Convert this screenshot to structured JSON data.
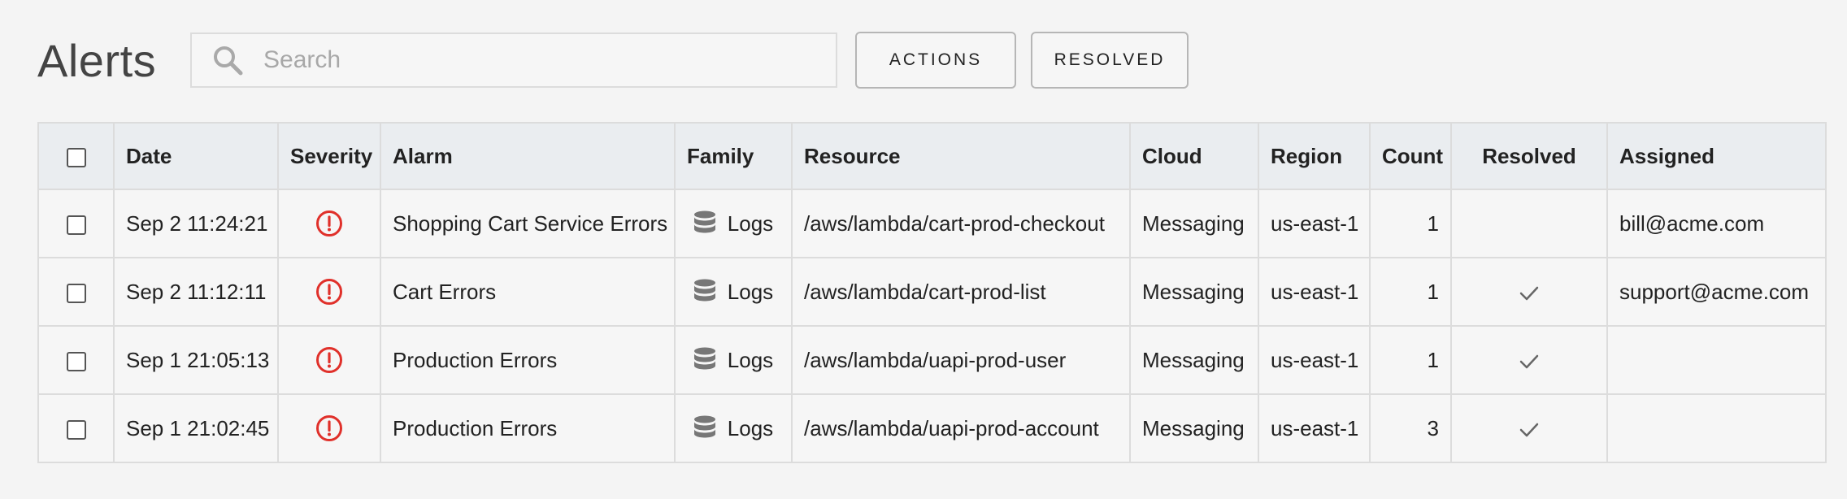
{
  "header": {
    "title": "Alerts",
    "search_placeholder": "Search",
    "search_value": "",
    "actions_label": "ACTIONS",
    "resolved_label": "RESOLVED"
  },
  "table": {
    "columns": [
      "Date",
      "Severity",
      "Alarm",
      "Family",
      "Resource",
      "Cloud",
      "Region",
      "Count",
      "Resolved",
      "Assigned"
    ],
    "rows": [
      {
        "date": "Sep 2 11:24:21",
        "severity": "error",
        "alarm": "Shopping Cart Service Errors",
        "family": "Logs",
        "resource": "/aws/lambda/cart-prod-checkout",
        "cloud": "Messaging",
        "region": "us-east-1",
        "count": "1",
        "resolved": false,
        "assigned": "bill@acme.com"
      },
      {
        "date": "Sep 2 11:12:11",
        "severity": "error",
        "alarm": "Cart Errors",
        "family": "Logs",
        "resource": "/aws/lambda/cart-prod-list",
        "cloud": "Messaging",
        "region": "us-east-1",
        "count": "1",
        "resolved": true,
        "assigned": "support@acme.com"
      },
      {
        "date": "Sep 1 21:05:13",
        "severity": "error",
        "alarm": "Production Errors",
        "family": "Logs",
        "resource": "/aws/lambda/uapi-prod-user",
        "cloud": "Messaging",
        "region": "us-east-1",
        "count": "1",
        "resolved": true,
        "assigned": ""
      },
      {
        "date": "Sep 1 21:02:45",
        "severity": "error",
        "alarm": "Production Errors",
        "family": "Logs",
        "resource": "/aws/lambda/uapi-prod-account",
        "cloud": "Messaging",
        "region": "us-east-1",
        "count": "3",
        "resolved": true,
        "assigned": ""
      }
    ]
  },
  "icons": {
    "search": "search-icon",
    "severity": "alert-circle-icon",
    "family": "database-icon",
    "resolved": "check-icon"
  },
  "colors": {
    "severity_error": "#e0302a",
    "header_bg": "#eaedf0",
    "page_bg": "#f4f4f4"
  }
}
